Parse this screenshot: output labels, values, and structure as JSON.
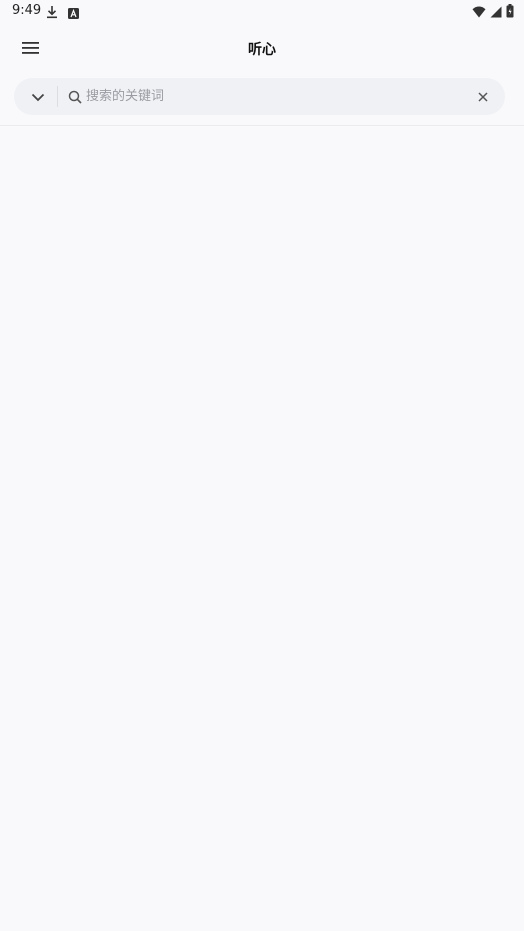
{
  "status_bar": {
    "time": "9:49",
    "left_icons": [
      "download-icon",
      "app-a-icon"
    ],
    "right_icons": [
      "wifi-icon",
      "signal-icon",
      "battery-icon"
    ]
  },
  "app_bar": {
    "title": "听心",
    "menu_icon": "menu-icon"
  },
  "search": {
    "placeholder": "搜索的关键词",
    "value": "",
    "dropdown_icon": "chevron-down-icon",
    "search_icon": "search-icon",
    "clear_icon": "close-icon"
  },
  "colors": {
    "background": "#f9f9fb",
    "search_background": "#f0f1f5",
    "placeholder": "#9a9ca3"
  }
}
